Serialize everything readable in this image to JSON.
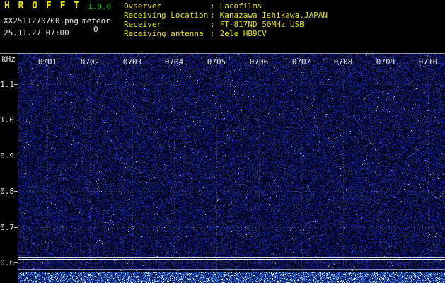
{
  "app": {
    "title": "H R O F F T",
    "version": "1.0.0",
    "filename": "XX2511270700.png",
    "mode_label": "meteor",
    "meteor_count": "0",
    "datetime": "25.11.27 07:00"
  },
  "info": {
    "colon": ":",
    "rows": [
      {
        "label": "Ovserver",
        "value": "Lacofilms"
      },
      {
        "label": "Receiving Location",
        "value": "Kanazawa Ishikawa,JAPAN"
      },
      {
        "label": "Receiver",
        "value": "FT-817ND 50MHz USB"
      },
      {
        "label": "Receiving antenna",
        "value": "2ele HB9CV"
      }
    ]
  },
  "spectrogram": {
    "freq_unit": "kHz",
    "time_labels": [
      "0701",
      "0702",
      "0703",
      "0704",
      "0705",
      "0706",
      "0707",
      "0708",
      "0709",
      "0710"
    ],
    "freq_labels": [
      "1.1",
      "1.0",
      "0.9",
      "0.8",
      "0.7",
      "0.6"
    ],
    "colors": {
      "background": "#000000",
      "noise_blue": "#2038b0",
      "noise_speck": "#ffffff",
      "gridline": "#becbff",
      "level_line_bright": "#ffffff",
      "level_line_dim": "#8a92b4",
      "axis_text": "#e8e8e8",
      "label_yellow": "#e8e800",
      "version_green": "#00c400",
      "title_yellow": "#f5e400"
    }
  }
}
